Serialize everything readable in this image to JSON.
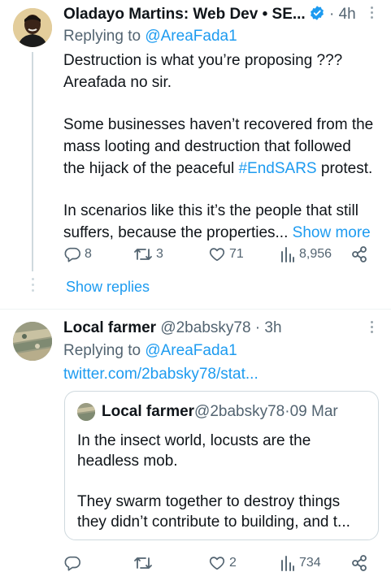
{
  "tweet1": {
    "author_name": "Oladayo Martins: Web Dev • SE...",
    "time": "4h",
    "replying_prefix": "Replying to ",
    "replying_handle": "@AreaFada1",
    "para1_line1": "Destruction is what you’re proposing ???",
    "para1_line2": "Areafada no sir.",
    "para2_line1": "Some businesses haven’t recovered from the",
    "para2_line2": "mass looting and destruction that followed",
    "para2_line3_pre": "the hijack of the peaceful ",
    "para2_hashtag": "#EndSARS",
    "para2_line3_post": " protest.",
    "para3_line1": "In scenarios like this it’s the people that still",
    "para3_line2": "suffers, because the properties...",
    "show_more": "Show more",
    "replies": "8",
    "retweets": "3",
    "likes": "71",
    "views": "8,956",
    "show_replies": "Show replies"
  },
  "tweet2": {
    "author_name": "Local farmer",
    "handle": "@2babsky78",
    "time": "3h",
    "replying_prefix": "Replying to ",
    "replying_handle": "@AreaFada1",
    "link": "twitter.com/2babsky78/stat...",
    "replies": "",
    "retweets": "",
    "likes": "2",
    "views": "734",
    "quote": {
      "author_name": "Local farmer",
      "handle": "@2babsky78",
      "date": "09 Mar",
      "para1_line1": "In the insect world, locusts are the",
      "para1_line2": "headless mob.",
      "para2_line1": "They swarm together to destroy things",
      "para2_line2": "they didn’t contribute to building, and t..."
    }
  },
  "colors": {
    "link_blue": "#1d9bf0",
    "text": "#0f1419",
    "secondary": "#536471",
    "border": "#cfd9de"
  },
  "icons": [
    "verified-badge-icon",
    "more-icon",
    "reply-icon",
    "retweet-icon",
    "like-icon",
    "views-icon",
    "share-icon"
  ]
}
